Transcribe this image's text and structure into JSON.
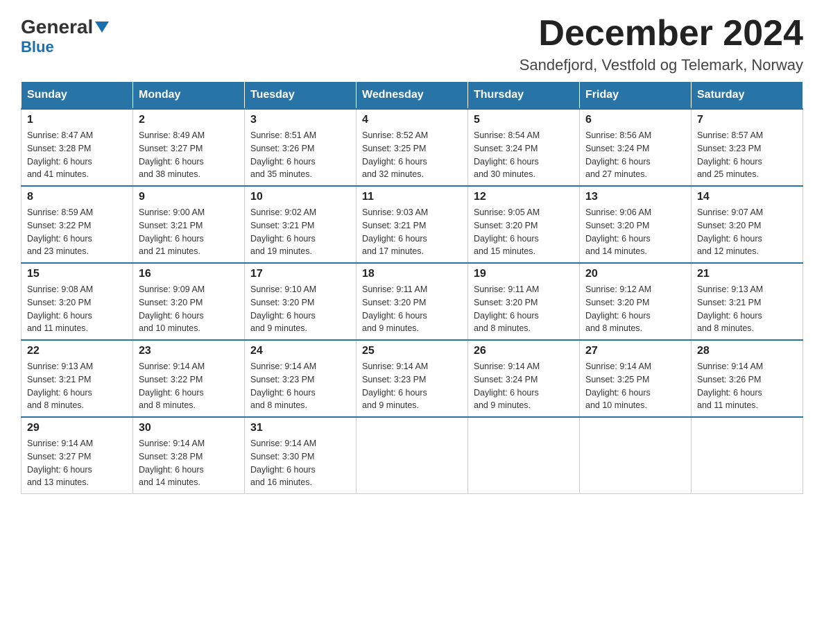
{
  "header": {
    "logo_general": "General",
    "logo_blue": "Blue",
    "main_title": "December 2024",
    "subtitle": "Sandefjord, Vestfold og Telemark, Norway"
  },
  "days_header": [
    "Sunday",
    "Monday",
    "Tuesday",
    "Wednesday",
    "Thursday",
    "Friday",
    "Saturday"
  ],
  "weeks": [
    [
      {
        "day": "1",
        "sunrise": "Sunrise: 8:47 AM",
        "sunset": "Sunset: 3:28 PM",
        "daylight": "Daylight: 6 hours",
        "daylight2": "and 41 minutes."
      },
      {
        "day": "2",
        "sunrise": "Sunrise: 8:49 AM",
        "sunset": "Sunset: 3:27 PM",
        "daylight": "Daylight: 6 hours",
        "daylight2": "and 38 minutes."
      },
      {
        "day": "3",
        "sunrise": "Sunrise: 8:51 AM",
        "sunset": "Sunset: 3:26 PM",
        "daylight": "Daylight: 6 hours",
        "daylight2": "and 35 minutes."
      },
      {
        "day": "4",
        "sunrise": "Sunrise: 8:52 AM",
        "sunset": "Sunset: 3:25 PM",
        "daylight": "Daylight: 6 hours",
        "daylight2": "and 32 minutes."
      },
      {
        "day": "5",
        "sunrise": "Sunrise: 8:54 AM",
        "sunset": "Sunset: 3:24 PM",
        "daylight": "Daylight: 6 hours",
        "daylight2": "and 30 minutes."
      },
      {
        "day": "6",
        "sunrise": "Sunrise: 8:56 AM",
        "sunset": "Sunset: 3:24 PM",
        "daylight": "Daylight: 6 hours",
        "daylight2": "and 27 minutes."
      },
      {
        "day": "7",
        "sunrise": "Sunrise: 8:57 AM",
        "sunset": "Sunset: 3:23 PM",
        "daylight": "Daylight: 6 hours",
        "daylight2": "and 25 minutes."
      }
    ],
    [
      {
        "day": "8",
        "sunrise": "Sunrise: 8:59 AM",
        "sunset": "Sunset: 3:22 PM",
        "daylight": "Daylight: 6 hours",
        "daylight2": "and 23 minutes."
      },
      {
        "day": "9",
        "sunrise": "Sunrise: 9:00 AM",
        "sunset": "Sunset: 3:21 PM",
        "daylight": "Daylight: 6 hours",
        "daylight2": "and 21 minutes."
      },
      {
        "day": "10",
        "sunrise": "Sunrise: 9:02 AM",
        "sunset": "Sunset: 3:21 PM",
        "daylight": "Daylight: 6 hours",
        "daylight2": "and 19 minutes."
      },
      {
        "day": "11",
        "sunrise": "Sunrise: 9:03 AM",
        "sunset": "Sunset: 3:21 PM",
        "daylight": "Daylight: 6 hours",
        "daylight2": "and 17 minutes."
      },
      {
        "day": "12",
        "sunrise": "Sunrise: 9:05 AM",
        "sunset": "Sunset: 3:20 PM",
        "daylight": "Daylight: 6 hours",
        "daylight2": "and 15 minutes."
      },
      {
        "day": "13",
        "sunrise": "Sunrise: 9:06 AM",
        "sunset": "Sunset: 3:20 PM",
        "daylight": "Daylight: 6 hours",
        "daylight2": "and 14 minutes."
      },
      {
        "day": "14",
        "sunrise": "Sunrise: 9:07 AM",
        "sunset": "Sunset: 3:20 PM",
        "daylight": "Daylight: 6 hours",
        "daylight2": "and 12 minutes."
      }
    ],
    [
      {
        "day": "15",
        "sunrise": "Sunrise: 9:08 AM",
        "sunset": "Sunset: 3:20 PM",
        "daylight": "Daylight: 6 hours",
        "daylight2": "and 11 minutes."
      },
      {
        "day": "16",
        "sunrise": "Sunrise: 9:09 AM",
        "sunset": "Sunset: 3:20 PM",
        "daylight": "Daylight: 6 hours",
        "daylight2": "and 10 minutes."
      },
      {
        "day": "17",
        "sunrise": "Sunrise: 9:10 AM",
        "sunset": "Sunset: 3:20 PM",
        "daylight": "Daylight: 6 hours",
        "daylight2": "and 9 minutes."
      },
      {
        "day": "18",
        "sunrise": "Sunrise: 9:11 AM",
        "sunset": "Sunset: 3:20 PM",
        "daylight": "Daylight: 6 hours",
        "daylight2": "and 9 minutes."
      },
      {
        "day": "19",
        "sunrise": "Sunrise: 9:11 AM",
        "sunset": "Sunset: 3:20 PM",
        "daylight": "Daylight: 6 hours",
        "daylight2": "and 8 minutes."
      },
      {
        "day": "20",
        "sunrise": "Sunrise: 9:12 AM",
        "sunset": "Sunset: 3:20 PM",
        "daylight": "Daylight: 6 hours",
        "daylight2": "and 8 minutes."
      },
      {
        "day": "21",
        "sunrise": "Sunrise: 9:13 AM",
        "sunset": "Sunset: 3:21 PM",
        "daylight": "Daylight: 6 hours",
        "daylight2": "and 8 minutes."
      }
    ],
    [
      {
        "day": "22",
        "sunrise": "Sunrise: 9:13 AM",
        "sunset": "Sunset: 3:21 PM",
        "daylight": "Daylight: 6 hours",
        "daylight2": "and 8 minutes."
      },
      {
        "day": "23",
        "sunrise": "Sunrise: 9:14 AM",
        "sunset": "Sunset: 3:22 PM",
        "daylight": "Daylight: 6 hours",
        "daylight2": "and 8 minutes."
      },
      {
        "day": "24",
        "sunrise": "Sunrise: 9:14 AM",
        "sunset": "Sunset: 3:23 PM",
        "daylight": "Daylight: 6 hours",
        "daylight2": "and 8 minutes."
      },
      {
        "day": "25",
        "sunrise": "Sunrise: 9:14 AM",
        "sunset": "Sunset: 3:23 PM",
        "daylight": "Daylight: 6 hours",
        "daylight2": "and 9 minutes."
      },
      {
        "day": "26",
        "sunrise": "Sunrise: 9:14 AM",
        "sunset": "Sunset: 3:24 PM",
        "daylight": "Daylight: 6 hours",
        "daylight2": "and 9 minutes."
      },
      {
        "day": "27",
        "sunrise": "Sunrise: 9:14 AM",
        "sunset": "Sunset: 3:25 PM",
        "daylight": "Daylight: 6 hours",
        "daylight2": "and 10 minutes."
      },
      {
        "day": "28",
        "sunrise": "Sunrise: 9:14 AM",
        "sunset": "Sunset: 3:26 PM",
        "daylight": "Daylight: 6 hours",
        "daylight2": "and 11 minutes."
      }
    ],
    [
      {
        "day": "29",
        "sunrise": "Sunrise: 9:14 AM",
        "sunset": "Sunset: 3:27 PM",
        "daylight": "Daylight: 6 hours",
        "daylight2": "and 13 minutes."
      },
      {
        "day": "30",
        "sunrise": "Sunrise: 9:14 AM",
        "sunset": "Sunset: 3:28 PM",
        "daylight": "Daylight: 6 hours",
        "daylight2": "and 14 minutes."
      },
      {
        "day": "31",
        "sunrise": "Sunrise: 9:14 AM",
        "sunset": "Sunset: 3:30 PM",
        "daylight": "Daylight: 6 hours",
        "daylight2": "and 16 minutes."
      },
      null,
      null,
      null,
      null
    ]
  ]
}
